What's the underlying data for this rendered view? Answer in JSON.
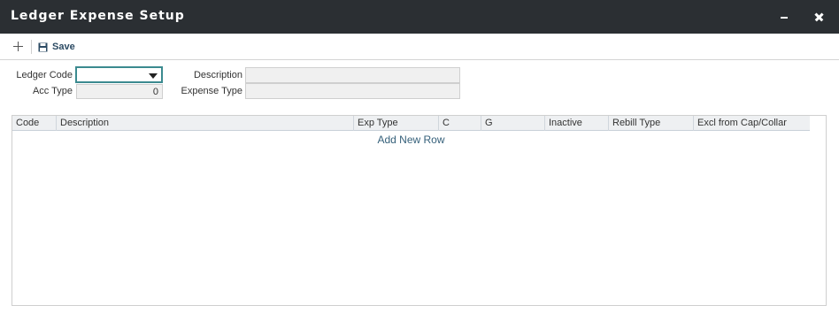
{
  "window": {
    "title": "Ledger Expense Setup"
  },
  "toolbar": {
    "save_label": "Save"
  },
  "form": {
    "ledger_code_label": "Ledger Code",
    "ledger_code_value": "",
    "acc_type_label": "Acc Type",
    "acc_type_value": "0",
    "description_label": "Description",
    "description_value": "",
    "expense_type_label": "Expense Type",
    "expense_type_value": ""
  },
  "grid": {
    "columns": [
      "Code",
      "Description",
      "Exp Type",
      "C",
      "G",
      "Inactive",
      "Rebill Type",
      "Excl from Cap/Collar"
    ],
    "add_row_label": "Add New Row",
    "rows": []
  },
  "icons": {
    "add": "plus-icon",
    "save": "floppy-disk-icon",
    "minimize": "minimize-icon",
    "close": "close-icon",
    "dropdown": "chevron-down-icon"
  },
  "colors": {
    "titlebar": "#2b2f33",
    "focus_border": "#3b8a8f",
    "link": "#35607a",
    "save_label": "#2b4a63"
  }
}
